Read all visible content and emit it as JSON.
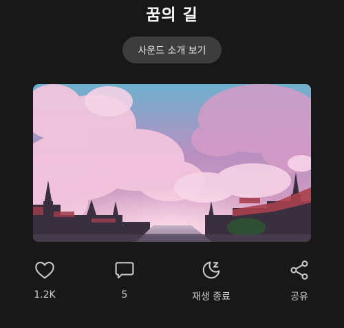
{
  "header": {
    "title": "꿈의 길",
    "intro_button_label": "사운드 소개 보기"
  },
  "actions": {
    "like_count": "1.2K",
    "comment_count": "5",
    "sleep_timer_label": "재생 종료",
    "share_label": "공유"
  },
  "icons": {
    "like": "heart-icon",
    "comment": "comment-icon",
    "sleep_timer": "moon-zz-icon",
    "share": "share-icon"
  },
  "colors": {
    "background": "#181818",
    "button_bg": "#3d3d3d",
    "text_primary": "#ffffff",
    "text_secondary": "#d0d0d0"
  }
}
